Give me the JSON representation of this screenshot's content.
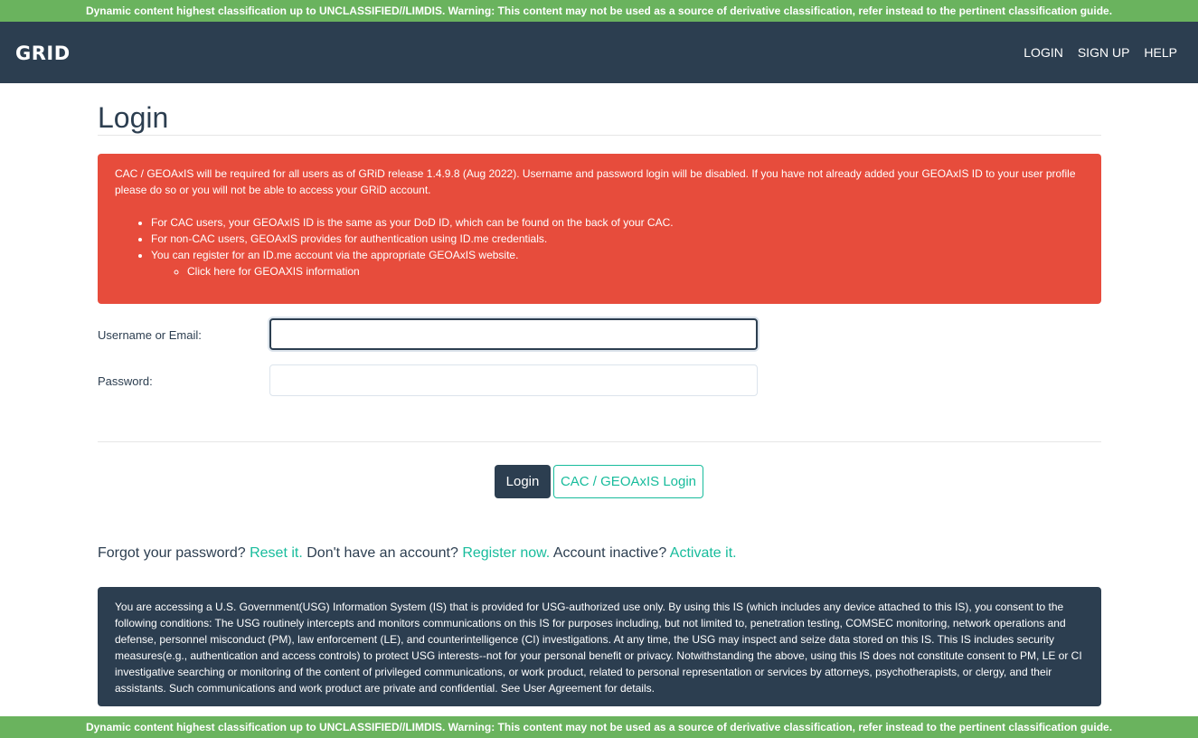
{
  "classification_banner": "Dynamic content highest classification up to UNCLASSIFIED//LIMDIS. Warning: This content may not be used as a source of derivative classification, refer instead to the pertinent classification guide.",
  "navbar": {
    "logo": "GRID",
    "links": [
      "LOGIN",
      "SIGN UP",
      "HELP"
    ]
  },
  "page": {
    "title": "Login"
  },
  "alert": {
    "message": "CAC / GEOAxIS will be required for all users as of GRiD release 1.4.9.8 (Aug 2022). Username and password login will be disabled. If you have not already added your GEOAxIS ID to your user profile please do so or you will not be able to access your GRiD account.",
    "bullets": [
      "For CAC users, your GEOAxIS ID is the same as your DoD ID, which can be found on the back of your CAC.",
      "For non-CAC users, GEOAxIS provides for authentication using ID.me credentials.",
      "You can register for an ID.me account via the appropriate GEOAxIS website."
    ],
    "sub_link": "Click here for GEOAXIS information"
  },
  "form": {
    "username_label": "Username or Email:",
    "username_value": "",
    "password_label": "Password:",
    "password_value": "",
    "login_button": "Login",
    "cac_button": "CAC / GEOAxIS Login"
  },
  "help_line": {
    "forgot_text": "Forgot your password?",
    "reset_link": "Reset it.",
    "no_account_text": "Don't have an account?",
    "register_link": "Register now.",
    "inactive_text": "Account inactive?",
    "activate_link": "Activate it."
  },
  "notice": "You are accessing a U.S. Government(USG) Information System (IS) that is provided for USG-authorized use only. By using this IS (which includes any device attached to this IS), you consent to the following conditions: The USG routinely intercepts and monitors communications on this IS for purposes including, but not limited to, penetration testing, COMSEC monitoring, network operations and defense, personnel misconduct (PM), law enforcement (LE), and counterintelligence (CI) investigations. At any time, the USG may inspect and seize data stored on this IS. This IS includes security measures(e.g., authentication and access controls) to protect USG interests--not for your personal benefit or privacy. Notwithstanding the above, using this IS does not constitute consent to PM, LE or CI investigative searching or monitoring of the content of privileged communications, or work product, related to personal representation or services by attorneys, psychotherapists, or clergy, and their assistants. Such communications and work product are private and confidential. See User Agreement for details.",
  "colors": {
    "banner": "#6ab35e",
    "navbar": "#2c3e50",
    "alert": "#e74c3c",
    "accent": "#18bc9c"
  }
}
